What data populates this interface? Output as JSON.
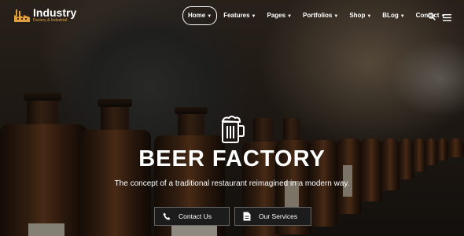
{
  "logo": {
    "name": "Industry",
    "tagline": "Factory & Industrial"
  },
  "menu": [
    {
      "label": "Home",
      "active": true
    },
    {
      "label": "Features"
    },
    {
      "label": "Pages"
    },
    {
      "label": "Portfolios"
    },
    {
      "label": "Shop"
    },
    {
      "label": "BLog"
    },
    {
      "label": "Contact"
    }
  ],
  "hero": {
    "title": "BEER FACTORY",
    "subtitle": "The concept of a traditional restaurant reimagined in a modern way.",
    "buttons": [
      {
        "label": "Contact Us",
        "icon": "phone-icon"
      },
      {
        "label": "Our Services",
        "icon": "document-icon"
      }
    ]
  },
  "icons": {
    "search": "search-icon",
    "menu": "hamburger-icon",
    "mug": "beer-mug-icon"
  },
  "colors": {
    "accent": "#e0a040",
    "button_bg": "#1c1c1c"
  }
}
